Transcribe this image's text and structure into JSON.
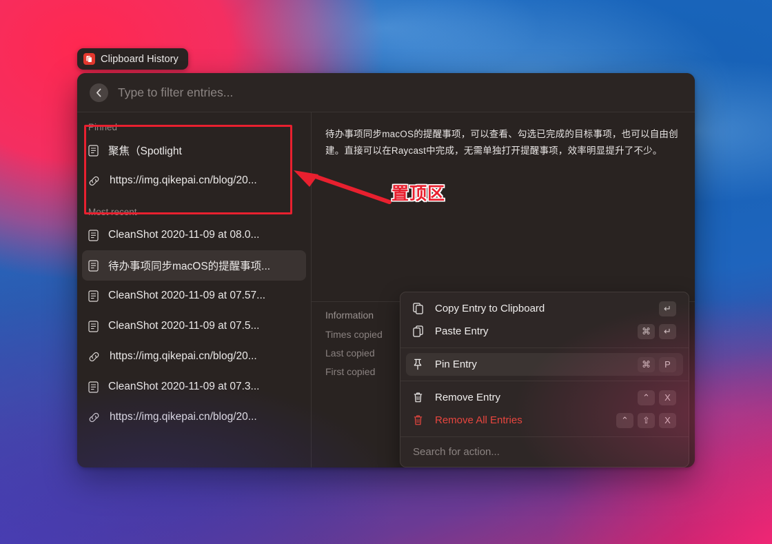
{
  "app_badge": {
    "label": "Clipboard History",
    "icon": "clipboard-icon"
  },
  "search": {
    "placeholder": "Type to filter entries...",
    "back_icon": "chevron-left-icon"
  },
  "sidebar": {
    "sections": [
      {
        "label": "Pinned",
        "items": [
          {
            "icon": "document-icon",
            "text": "聚焦（Spotlight"
          },
          {
            "icon": "link-icon",
            "text": "https://img.qikepai.cn/blog/20..."
          }
        ]
      },
      {
        "label": "Most recent",
        "items": [
          {
            "icon": "document-icon",
            "text": "CleanShot 2020-11-09 at 08.0...",
            "selected": false
          },
          {
            "icon": "document-icon",
            "text": "待办事项同步macOS的提醒事项...",
            "selected": true
          },
          {
            "icon": "document-icon",
            "text": "CleanShot 2020-11-09 at 07.57...",
            "selected": false
          },
          {
            "icon": "document-icon",
            "text": "CleanShot 2020-11-09 at 07.5...",
            "selected": false
          },
          {
            "icon": "link-icon",
            "text": "https://img.qikepai.cn/blog/20...",
            "selected": false
          },
          {
            "icon": "document-icon",
            "text": "CleanShot 2020-11-09 at 07.3...",
            "selected": false
          },
          {
            "icon": "link-icon",
            "text": "https://img.qikepai.cn/blog/20...",
            "selected": false
          }
        ]
      }
    ]
  },
  "detail": {
    "preview_text": "待办事项同步macOS的提醒事项，可以查看、勾选已完成的目标事项，也可以自由创建。直接可以在Raycast中完成，无需单独打开提醒事项，效率明显提升了不少。",
    "information_title": "Information",
    "meta_keys": [
      "Times copied",
      "Last copied",
      "First copied"
    ]
  },
  "action_panel": {
    "groups": [
      {
        "rows": [
          {
            "icon": "copy-icon",
            "label": "Copy Entry to Clipboard",
            "keys": [
              "↵"
            ],
            "selected": false,
            "danger": false
          },
          {
            "icon": "paste-icon",
            "label": "Paste Entry",
            "keys": [
              "⌘",
              "↵"
            ],
            "selected": false,
            "danger": false
          }
        ]
      },
      {
        "rows": [
          {
            "icon": "pin-icon",
            "label": "Pin Entry",
            "keys": [
              "⌘",
              "P"
            ],
            "selected": true,
            "danger": false
          }
        ]
      },
      {
        "rows": [
          {
            "icon": "trash-icon",
            "label": "Remove Entry",
            "keys": [
              "⌃",
              "X"
            ],
            "selected": false,
            "danger": false
          },
          {
            "icon": "trash-icon",
            "label": "Remove All Entries",
            "keys": [
              "⌃",
              "⇧",
              "X"
            ],
            "selected": false,
            "danger": true
          }
        ]
      }
    ],
    "search_placeholder": "Search for action..."
  },
  "annotation": {
    "label": "置顶区",
    "color": "#e8202f",
    "highlight_region": "Pinned section"
  }
}
